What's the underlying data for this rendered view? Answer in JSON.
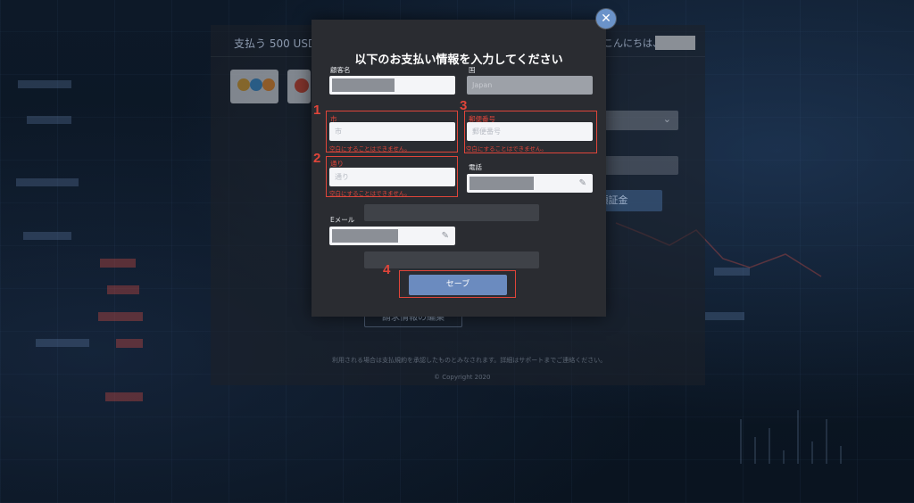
{
  "background": {
    "pay_label": "支払う 500 USD",
    "greeting": "こんにちは、",
    "deposit_button": "預証金",
    "edit_billing_button": "請求情報の編集",
    "note": "利用される場合は支払規約を承認したものとみなされます。詳細はサポートまでご連絡ください。",
    "copyright": "© Copyright 2020",
    "warning_icon": "warning-icon"
  },
  "modal": {
    "title": "以下のお支払い情報を入力してください",
    "close_icon": "close-icon",
    "fields": {
      "customer_name": {
        "label": "顧客名"
      },
      "country": {
        "label": "国",
        "value": "Japan"
      },
      "city": {
        "label": "市",
        "placeholder": "市",
        "error": "空白にすることはできません。"
      },
      "postal_code": {
        "label": "郵便番号",
        "placeholder": "郵便番号",
        "error": "空白にすることはできません。"
      },
      "street": {
        "label": "通り",
        "placeholder": "通り",
        "error": "空白にすることはできません。"
      },
      "phone": {
        "label": "電話"
      },
      "email": {
        "label": "Eメール"
      }
    },
    "save_label": "セーブ"
  },
  "annotations": [
    "1",
    "2",
    "3",
    "4"
  ],
  "colors": {
    "accent": "#6b8bbf",
    "error": "#e0453a",
    "modal_bg": "#2a2c31"
  }
}
